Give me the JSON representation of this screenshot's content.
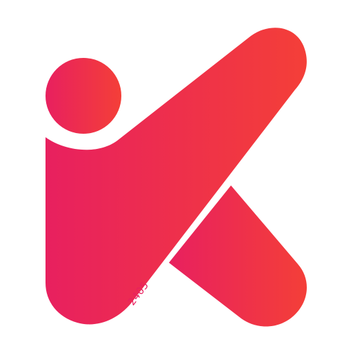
{
  "logo": {
    "version": "2405",
    "colors": {
      "gradient_start": "#e8205f",
      "gradient_end": "#f43f38",
      "version_text": "#e8205f",
      "background": "#ffffff"
    }
  }
}
